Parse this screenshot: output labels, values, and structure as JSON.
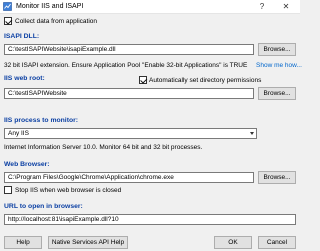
{
  "window": {
    "title": "Monitor IIS and ISAPI",
    "help_glyph": "?",
    "close_glyph": "✕"
  },
  "collect_data": {
    "label": "Collect data from application",
    "checked": true
  },
  "isapi_dll": {
    "section_label": "ISAPI DLL:",
    "path": "C:\\testISAPIWebsite\\isapiExample.dll",
    "browse_label": "Browse...",
    "info": "32 bit ISAPI extension. Ensure Application Pool \"Enable 32-bit Applications\" is TRUE",
    "show_me_how": "Show me how..."
  },
  "iis_web_root": {
    "section_label": "IIS web root:",
    "auto_permissions_label": "Automatically set directory permissions",
    "auto_permissions_checked": true,
    "path": "C:\\testISAPIWebsite",
    "browse_label": "Browse..."
  },
  "iis_process": {
    "section_label": "IIS process to monitor:",
    "selected": "Any IIS",
    "info": "Internet Information Server 10.0. Monitor 64 bit and 32 bit processes."
  },
  "web_browser": {
    "section_label": "Web Browser:",
    "path": "C:\\Program Files\\Google\\Chrome\\Application\\chrome.exe",
    "browse_label": "Browse...",
    "stop_iis_label": "Stop IIS when web browser is closed",
    "stop_iis_checked": false
  },
  "url": {
    "section_label": "URL to open in browser:",
    "value": "http://localhost:81\\isapiExample.dll?10"
  },
  "buttons": {
    "help": "Help",
    "native_help": "Native Services API Help",
    "ok": "OK",
    "cancel": "Cancel"
  }
}
